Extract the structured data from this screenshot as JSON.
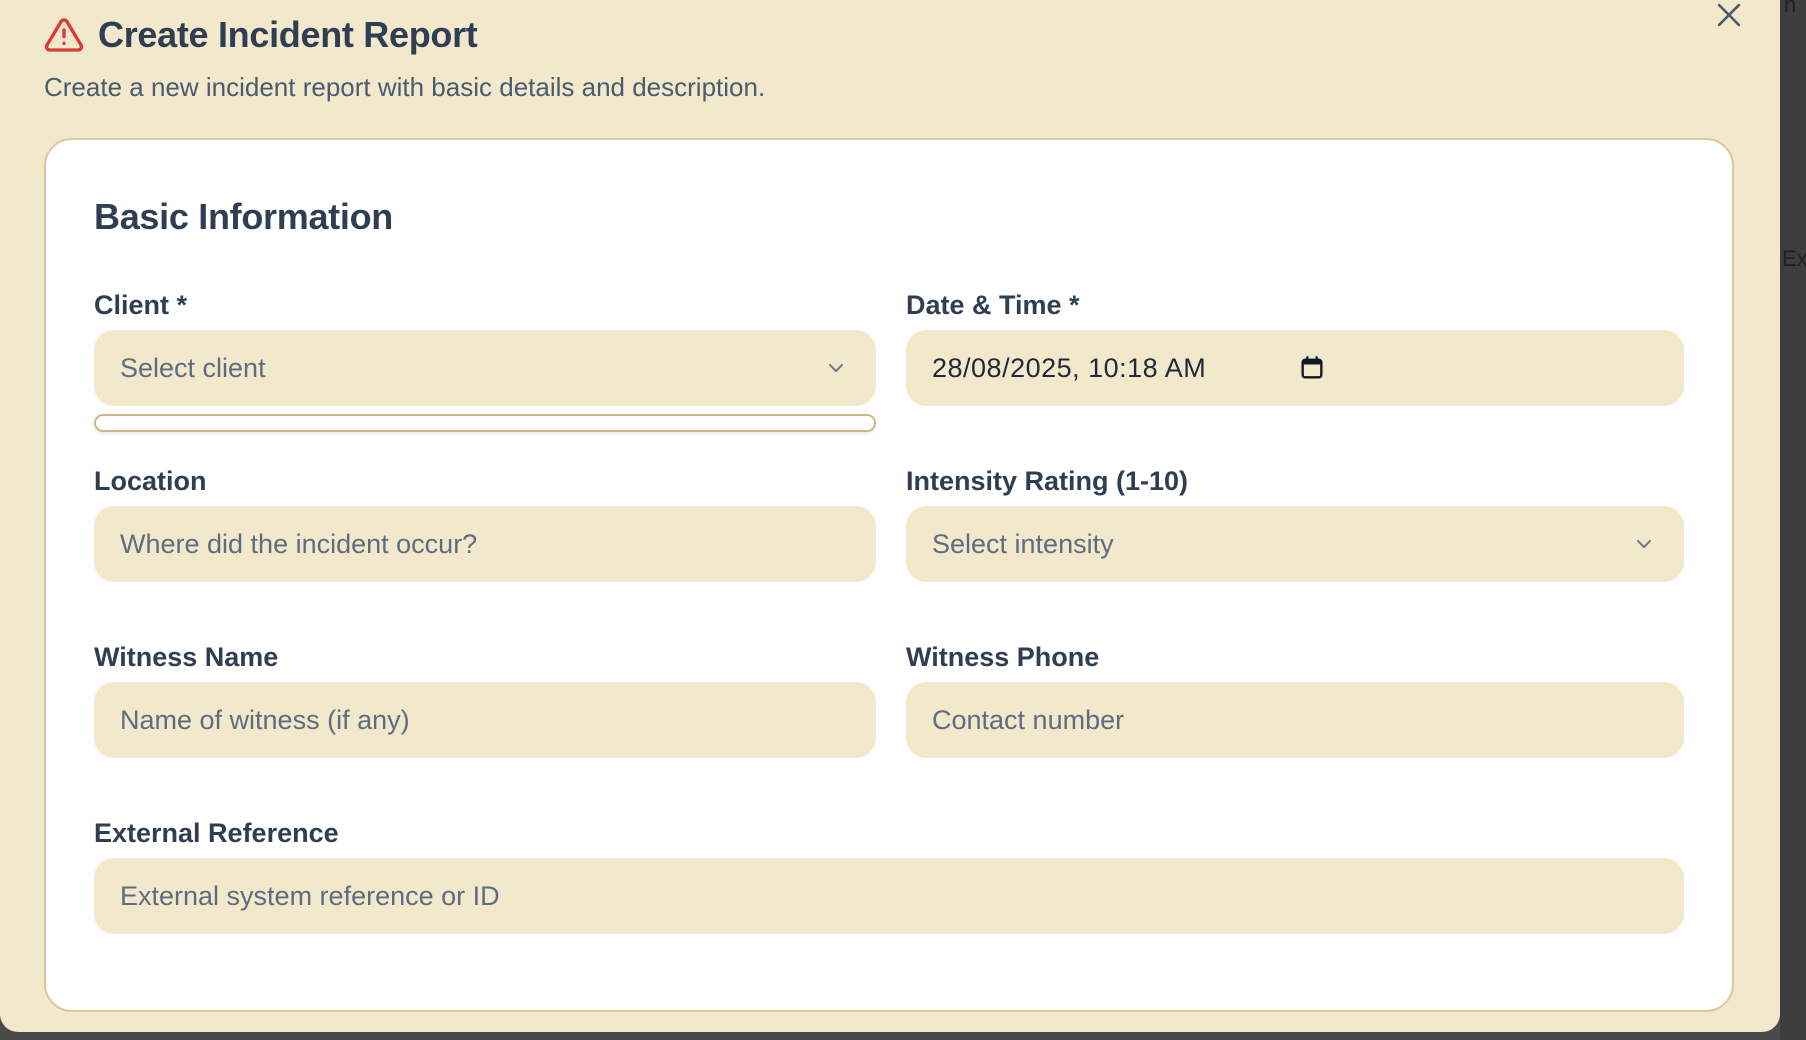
{
  "dialog": {
    "title": "Create Incident Report",
    "subtitle": "Create a new incident report with basic details and description.",
    "warning_icon": "warning-triangle-icon",
    "close_icon": "close-icon"
  },
  "card": {
    "title": "Basic Information"
  },
  "fields": {
    "client": {
      "label": "Client *",
      "value": "Select client"
    },
    "datetime": {
      "label": "Date & Time *",
      "value": "28/08/2025, 10:18  AM"
    },
    "location": {
      "label": "Location",
      "placeholder": "Where did the incident occur?"
    },
    "intensity": {
      "label": "Intensity Rating (1-10)",
      "value": "Select intensity"
    },
    "witness_name": {
      "label": "Witness Name",
      "placeholder": "Name of witness (if any)"
    },
    "witness_phone": {
      "label": "Witness Phone",
      "placeholder": "Contact number"
    },
    "external_ref": {
      "label": "External Reference",
      "placeholder": "External system reference or ID"
    }
  },
  "background": {
    "fragment_top": "n",
    "fragment_mid": "Ex"
  },
  "colors": {
    "dialog_bg": "#f2e8cb",
    "field_bg": "#f2e8cb",
    "card_bg": "#ffffff",
    "text_dark": "#2f3e52",
    "warning": "#d93a3a"
  }
}
